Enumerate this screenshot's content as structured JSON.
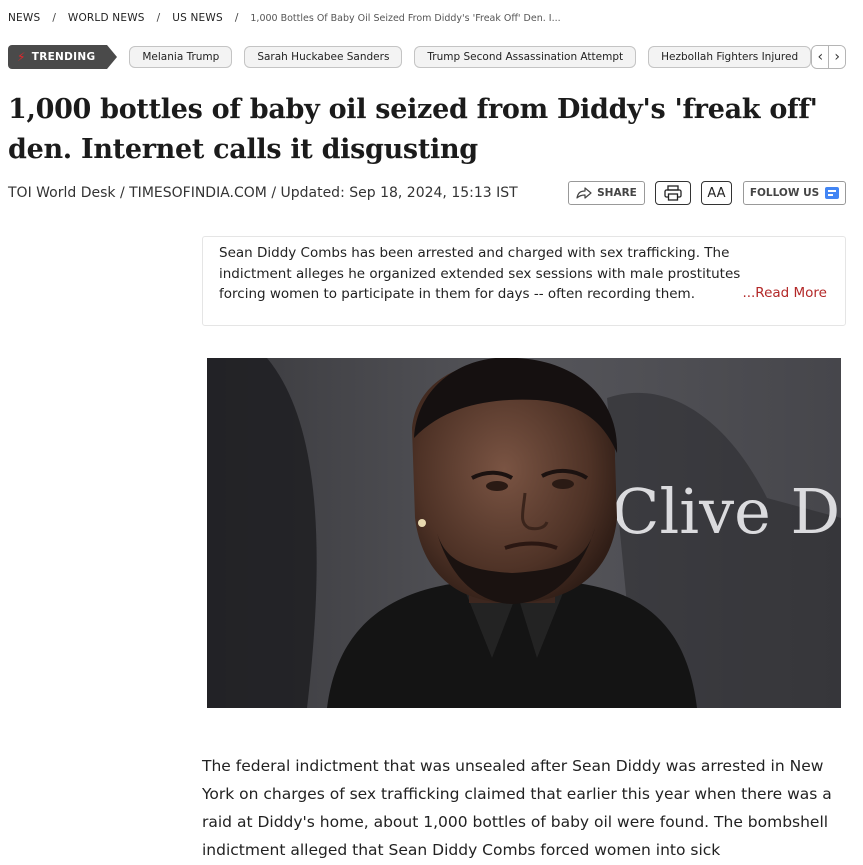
{
  "breadcrumb": {
    "items": [
      "NEWS",
      "WORLD NEWS",
      "US NEWS"
    ],
    "current": "1,000 Bottles Of Baby Oil Seized From Diddy's 'Freak Off' Den. I..."
  },
  "trending": {
    "label": "TRENDING",
    "icon": "lightning-bolt-icon",
    "topics": [
      "Melania Trump",
      "Sarah Huckabee Sanders",
      "Trump Second Assassination Attempt",
      "Hezbollah Fighters Injured"
    ]
  },
  "article": {
    "headline": "1,000 bottles of baby oil seized from Diddy's 'freak off' den. Internet calls it disgusting",
    "byline": "TOI World Desk / TIMESOFINDIA.COM / Updated: Sep 18, 2024, 15:13 IST",
    "summary": "Sean Diddy Combs has been arrested and charged with sex trafficking. The indictment alleges he organized extended sex sessions with male prostitutes forcing women to participate in them for days -- often recording them. Authoriti",
    "read_more": "...Read More",
    "image_backdrop_text": "Clive D",
    "body": "The federal indictment that was unsealed after Sean Diddy was arrested in New York on charges of sex trafficking claimed that earlier this year when there was a raid at Diddy's home, about 1,000 bottles of baby oil were found. The bombshell indictment alleged that Sean Diddy Combs forced women into sick"
  },
  "actions": {
    "share": "SHARE",
    "text_size": "AA",
    "follow": "FOLLOW US"
  },
  "colors": {
    "trending_bg": "#4a4a4a",
    "bolt": "#e4262a",
    "read_more": "#b32828"
  }
}
